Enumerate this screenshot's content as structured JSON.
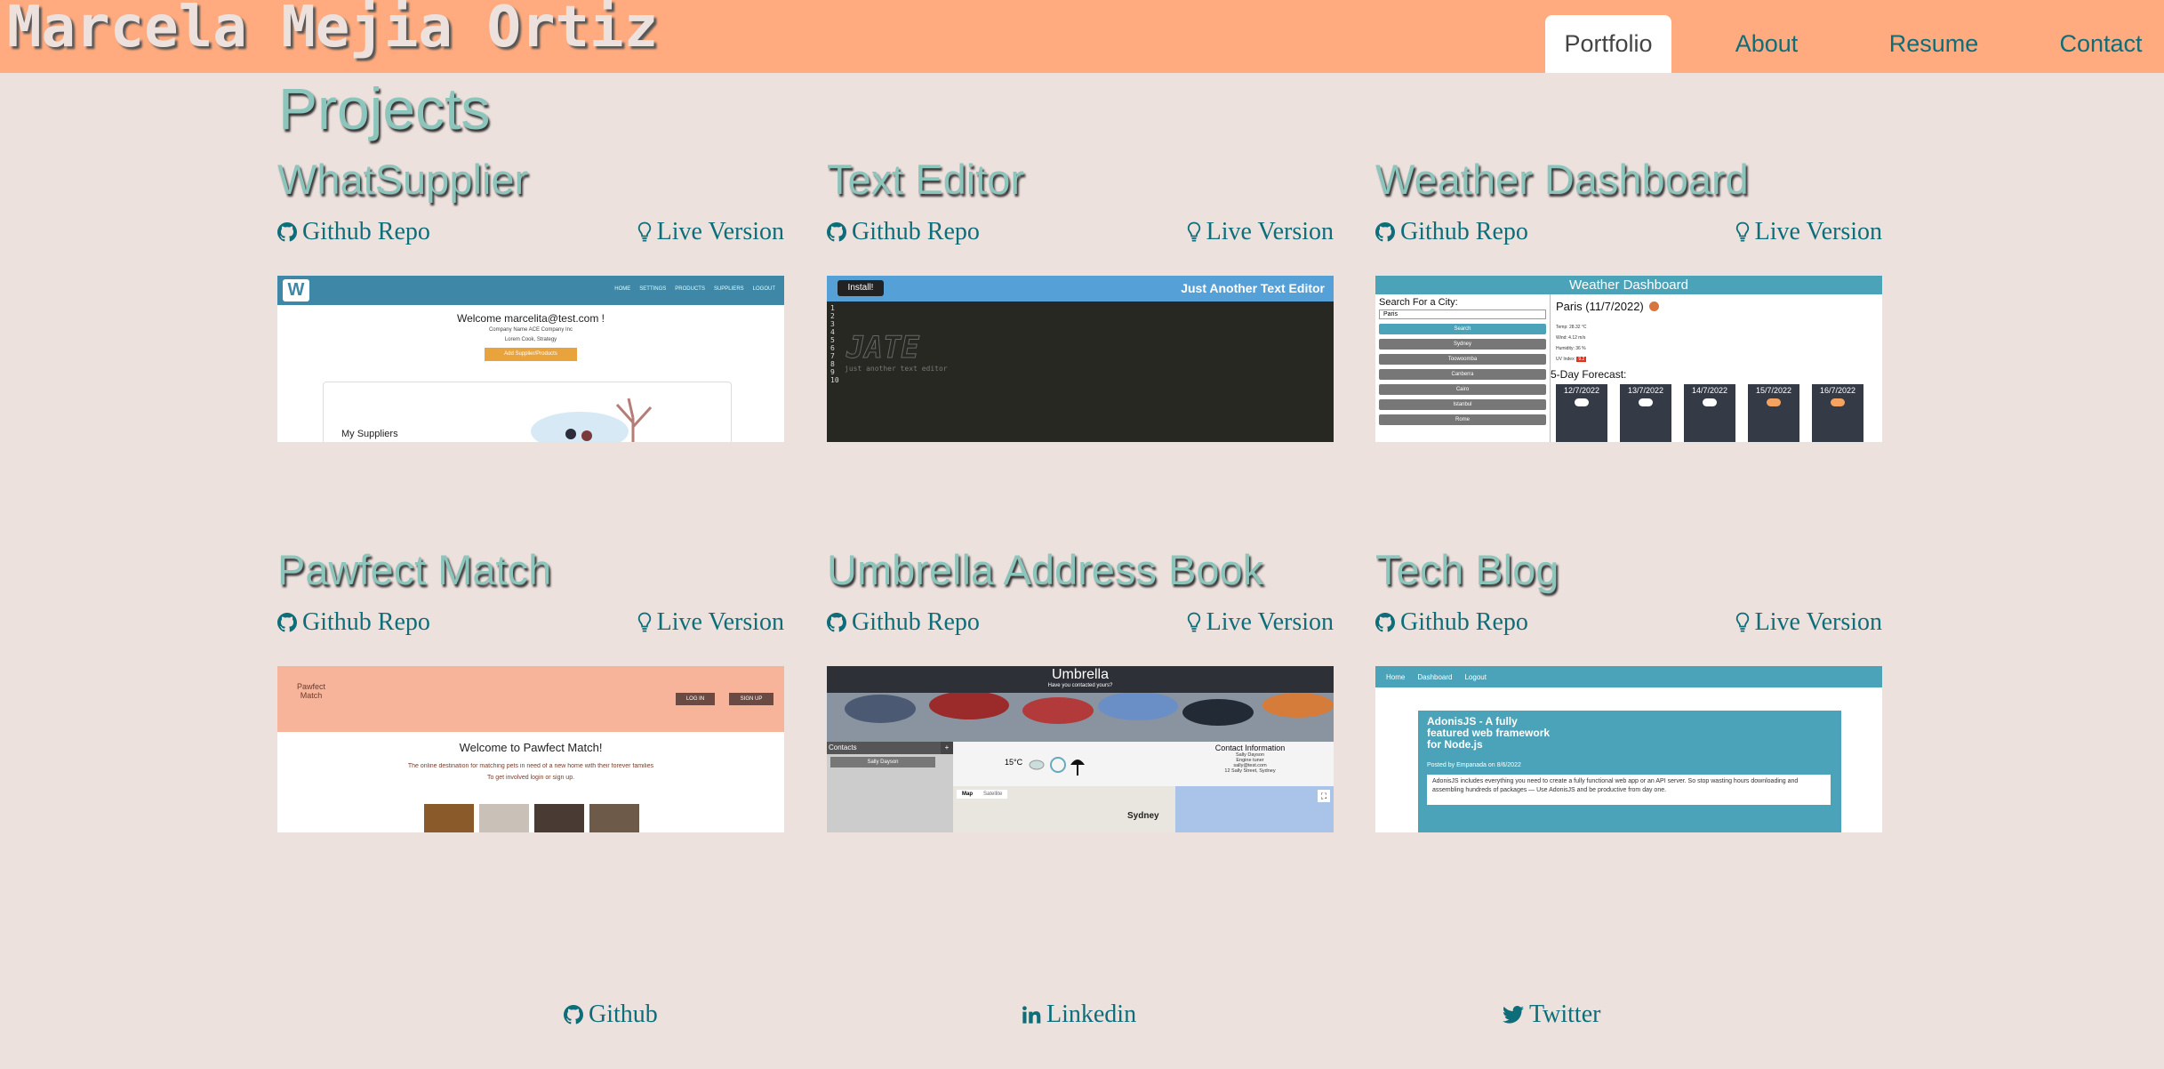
{
  "header": {
    "site_title": "Marcela Mejia Ortiz",
    "nav": [
      "Portfolio",
      "About",
      "Resume",
      "Contact"
    ]
  },
  "projects": {
    "title": "Projects",
    "github_label": "Github Repo",
    "live_label": "Live Version",
    "items": [
      {
        "name": "WhatSupplier",
        "preview": {
          "nav": [
            "HOME",
            "SETTINGS",
            "PRODUCTS",
            "SUPPLIERS",
            "LOGOUT"
          ],
          "welcome": "Welcome marcelita@test.com !",
          "line1": "Company Name ACE Company Inc",
          "line2": "Lorem Cook, Strategy",
          "button": "Add Supplier/Products",
          "section": "My Suppliers"
        }
      },
      {
        "name": "Text Editor",
        "preview": {
          "button": "Install!",
          "header": "Just Another Text Editor",
          "lines": [
            "1",
            "2",
            "3",
            "4",
            "5",
            "6",
            "7",
            "8",
            "9",
            "10"
          ],
          "caption": "just another text editor"
        }
      },
      {
        "name": "Weather Dashboard",
        "preview": {
          "banner": "Weather Dashboard",
          "search_label": "Search For a City:",
          "search_value": "Paris",
          "search_button": "Search",
          "cities": [
            "Sydney",
            "Toowoomba",
            "Canberra",
            "Cairo",
            "Istanbul",
            "Rome"
          ],
          "current": "Paris (11/7/2022)",
          "stats": [
            "Temp: 28.32 °C",
            "Wind: 4.12 m/s",
            "Humidity: 36 %",
            "UV Index:"
          ],
          "uv": "9.2",
          "forecast_title": "5-Day Forecast:",
          "forecast": [
            "12/7/2022",
            "13/7/2022",
            "14/7/2022",
            "15/7/2022",
            "16/7/2022"
          ]
        }
      },
      {
        "name": "Pawfect Match",
        "preview": {
          "logo": "Pawfect Match",
          "login": "LOG IN",
          "signup": "SIGN UP",
          "welcome": "Welcome to Pawfect Match!",
          "line1": "The online destination for matching pets in need of a new home with their forever families",
          "line2": "To get involved login or sign up."
        }
      },
      {
        "name": "Umbrella Address Book",
        "preview": {
          "title": "Umbrella",
          "subtitle": "Have you contacted yours?",
          "contacts": "Contacts",
          "contact_item": "Sally Dayson",
          "temp": "15°C",
          "info_title": "Contact Information",
          "info_lines": [
            "Sally Dayson",
            "Engine tuner",
            "sally@test.com",
            "12 Sally Street, Sydney"
          ],
          "map_tabs": [
            "Map",
            "Satellite"
          ],
          "map_label": "Sydney"
        }
      },
      {
        "name": "Tech Blog",
        "preview": {
          "nav": [
            "Home",
            "Dashboard",
            "Logout"
          ],
          "post_title": "AdonisJS - A fully featured web framework for Node.js",
          "post_meta": "Posted by Empanada on 8/6/2022",
          "post_body": "AdonisJS includes everything you need to create a fully functional web app or an API server. So stop wasting hours downloading and assembling hundreds of packages — Use AdonisJS and be productive from day one."
        }
      }
    ]
  },
  "footer": {
    "links": [
      "Github",
      "Linkedin",
      "Twitter"
    ]
  },
  "colors": {
    "header_bg": "#ffab7f",
    "page_bg": "#ede1dd",
    "accent": "#0d6e7a",
    "heading": "#8cc5bc"
  }
}
